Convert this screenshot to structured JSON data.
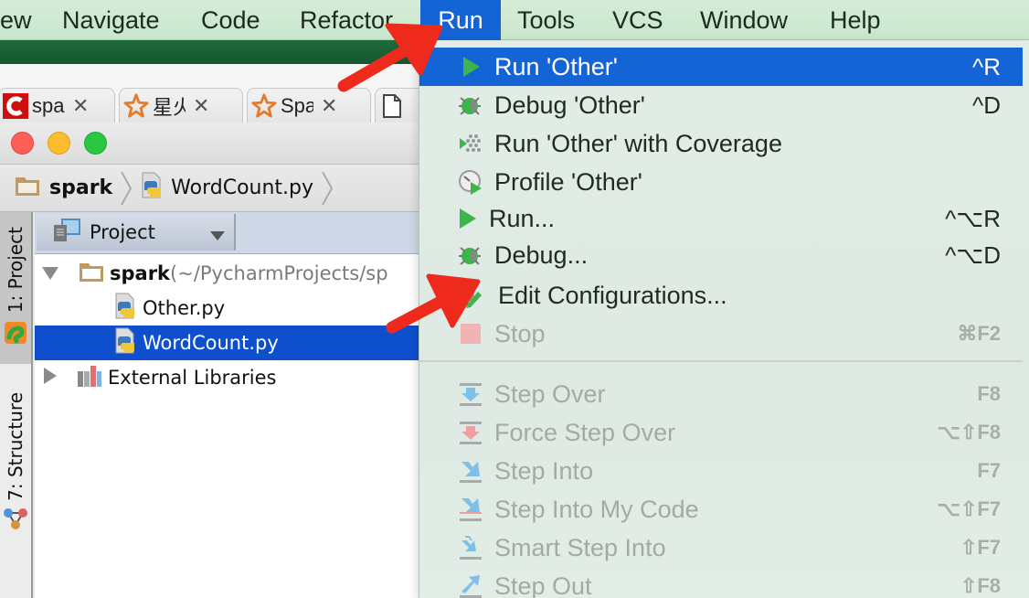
{
  "menubar": {
    "items": [
      "ew",
      "Navigate",
      "Code",
      "Refactor",
      "Run",
      "Tools",
      "VCS",
      "Window",
      "Help"
    ],
    "active": "Run"
  },
  "browser_tabs": [
    {
      "label": "spa",
      "icon": "c-logo-icon"
    },
    {
      "label": "星火",
      "icon": "star-icon"
    },
    {
      "label": "Spa",
      "icon": "star-icon"
    },
    {
      "label": "",
      "icon": "document-icon"
    }
  ],
  "ide": {
    "breadcrumb": [
      {
        "label": "spark",
        "icon": "folder-icon"
      },
      {
        "label": "WordCount.py",
        "icon": "python-file-icon"
      }
    ],
    "left_tool_tabs": [
      {
        "label": "1: Project",
        "selected": true
      },
      {
        "label": "7: Structure",
        "selected": false
      }
    ],
    "panel": {
      "view_selector": "Project",
      "tree": [
        {
          "label": "spark",
          "suffix": " (~/PycharmProjects/sp",
          "type": "folder",
          "expanded": true,
          "depth": 0
        },
        {
          "label": "Other.py",
          "type": "python-file",
          "depth": 1
        },
        {
          "label": "WordCount.py",
          "type": "python-file",
          "depth": 1,
          "selected": true
        },
        {
          "label": "External Libraries",
          "type": "library",
          "expanded": false,
          "depth": 0
        }
      ]
    }
  },
  "run_menu": {
    "items": [
      {
        "label": "Run 'Other'",
        "shortcut": "^R",
        "icon": "run-icon",
        "highlighted": true,
        "enabled": true
      },
      {
        "label": "Debug 'Other'",
        "shortcut": "^D",
        "icon": "debug-icon",
        "enabled": true
      },
      {
        "label": "Run 'Other' with Coverage",
        "shortcut": "",
        "icon": "coverage-icon",
        "enabled": true
      },
      {
        "label": "Profile 'Other'",
        "shortcut": "",
        "icon": "profile-icon",
        "enabled": true
      },
      {
        "label": "Run...",
        "shortcut": "^⌥R",
        "icon": "run-icon",
        "enabled": true
      },
      {
        "label": "Debug...",
        "shortcut": "^⌥D",
        "icon": "debug-icon",
        "enabled": true
      },
      {
        "label": "Edit Configurations...",
        "shortcut": "",
        "icon": "edit-config-icon",
        "enabled": true
      },
      {
        "label": "Stop",
        "shortcut": "⌘F2",
        "icon": "stop-icon",
        "enabled": false
      },
      {
        "label": "Step Over",
        "shortcut": "F8",
        "icon": "step-over-icon",
        "enabled": false
      },
      {
        "label": "Force Step Over",
        "shortcut": "⌥⇧F8",
        "icon": "force-step-over-icon",
        "enabled": false
      },
      {
        "label": "Step Into",
        "shortcut": "F7",
        "icon": "step-into-icon",
        "enabled": false
      },
      {
        "label": "Step Into My Code",
        "shortcut": "⌥⇧F7",
        "icon": "step-into-my-code-icon",
        "enabled": false
      },
      {
        "label": "Smart Step Into",
        "shortcut": "⇧F7",
        "icon": "smart-step-into-icon",
        "enabled": false
      },
      {
        "label": "Step Out",
        "shortcut": "⇧F8",
        "icon": "step-out-icon",
        "enabled": false
      }
    ]
  },
  "colors": {
    "menu_highlight": "#1464d6",
    "tree_selection": "#0e4fce",
    "annotation_arrow": "#ee2a1c"
  }
}
